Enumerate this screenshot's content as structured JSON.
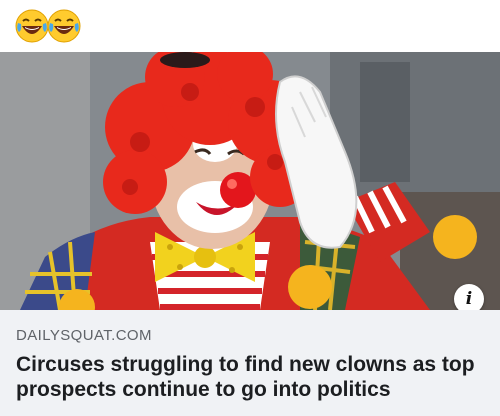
{
  "header": {
    "emojis": [
      "face-with-tears-of-joy-icon",
      "face-with-tears-of-joy-icon"
    ]
  },
  "link_card": {
    "image": {
      "subject": "clown-photo",
      "info_icon": "i"
    },
    "domain": "DAILYSQUAT.COM",
    "headline": "Circuses struggling to find new clowns as top prospects continue to go into politics"
  },
  "colors": {
    "caption_bg": "#f0f2f5",
    "wig": "#e8291c",
    "emoji_yellow": "#ffcb2e",
    "tear_blue": "#4aa8e8"
  }
}
